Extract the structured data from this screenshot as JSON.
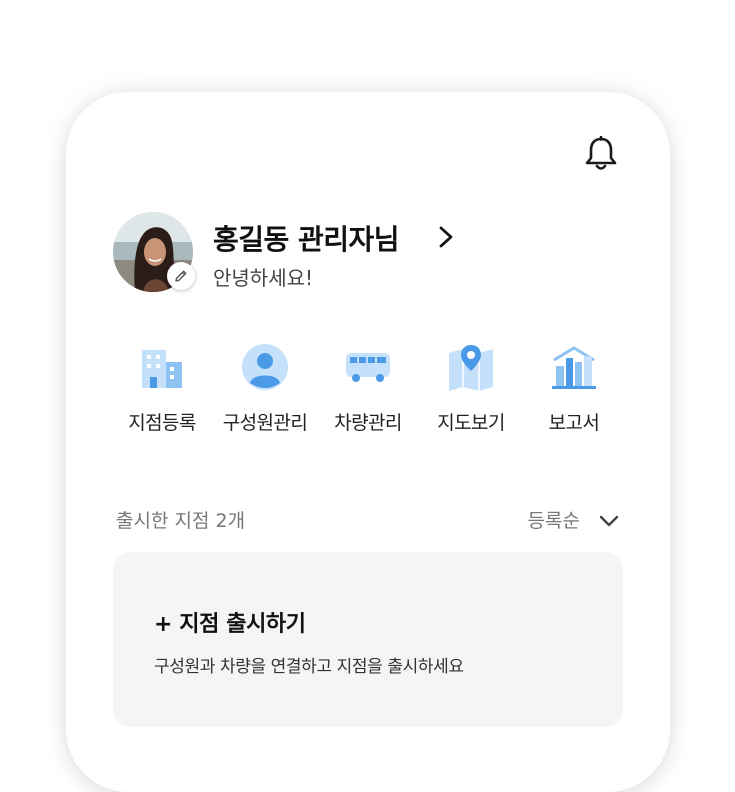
{
  "header": {
    "notification_icon": "bell-icon"
  },
  "profile": {
    "name": "홍길동 관리자님",
    "greeting": "안녕하세요!",
    "edit_icon": "pencil-icon",
    "chevron_icon": "chevron-right-icon"
  },
  "menu": {
    "items": [
      {
        "label": "지점등록",
        "icon": "building-icon"
      },
      {
        "label": "구성원관리",
        "icon": "person-icon"
      },
      {
        "label": "차량관리",
        "icon": "bus-icon"
      },
      {
        "label": "지도보기",
        "icon": "map-pin-icon"
      },
      {
        "label": "보고서",
        "icon": "bar-chart-icon"
      }
    ]
  },
  "branches": {
    "count_label": "출시한 지점 2개",
    "sort_label": "등록순",
    "sort_icon": "chevron-down-icon"
  },
  "launch_card": {
    "title": "+ 지점 출시하기",
    "description": "구성원과 차량을 연결하고 지점을 출시하세요"
  },
  "colors": {
    "icon_light": "#c5e0fa",
    "icon_mid": "#8ec2f2",
    "icon_dark": "#4a9ae8",
    "card_bg": "#f5f5f5",
    "text_primary": "#111111",
    "text_secondary": "#777777"
  }
}
